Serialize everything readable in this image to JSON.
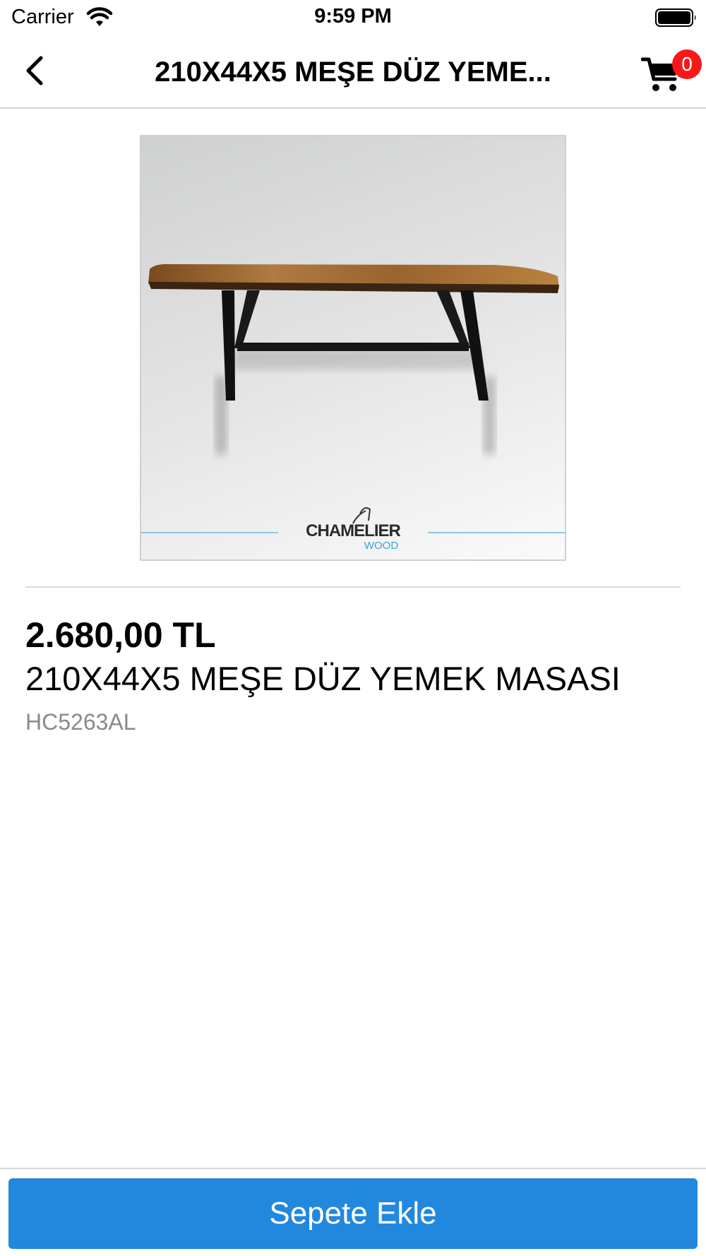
{
  "status_bar": {
    "carrier": "Carrier",
    "time": "9:59 PM"
  },
  "nav": {
    "title": "210X44X5 MEŞE DÜZ YEME...",
    "cart_count": "0"
  },
  "product": {
    "price": "2.680,00 TL",
    "name": "210X44X5 MEŞE DÜZ YEMEK MASASI",
    "sku": "HC5263AL",
    "image_logo": "CHAMELIER WOOD"
  },
  "actions": {
    "add_to_cart_label": "Sepete Ekle"
  },
  "colors": {
    "accent": "#2288dd",
    "badge": "#fb1717",
    "sku_text": "#8a8a8a"
  },
  "icons": {
    "back": "chevron-left-icon",
    "cart": "shopping-cart-icon",
    "wifi": "wifi-icon",
    "battery": "battery-icon"
  }
}
